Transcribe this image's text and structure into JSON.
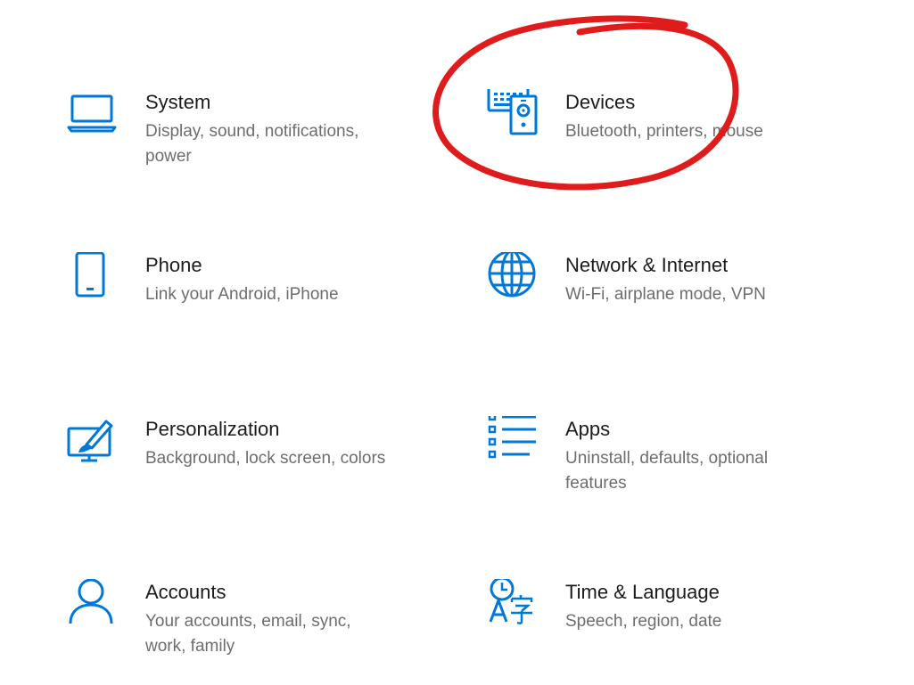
{
  "accent_color": "#0078d7",
  "annotation_color": "#e01b1b",
  "tiles": [
    {
      "title": "System",
      "description": "Display, sound, notifications, power",
      "icon": "laptop-icon"
    },
    {
      "title": "Devices",
      "description": "Bluetooth, printers, mouse",
      "icon": "devices-icon"
    },
    {
      "title": "Phone",
      "description": "Link your Android, iPhone",
      "icon": "phone-icon"
    },
    {
      "title": "Network & Internet",
      "description": "Wi-Fi, airplane mode, VPN",
      "icon": "globe-icon"
    },
    {
      "title": "Personalization",
      "description": "Background, lock screen, colors",
      "icon": "personalization-icon"
    },
    {
      "title": "Apps",
      "description": "Uninstall, defaults, optional features",
      "icon": "apps-list-icon"
    },
    {
      "title": "Accounts",
      "description": "Your accounts, email, sync, work, family",
      "icon": "person-icon"
    },
    {
      "title": "Time & Language",
      "description": "Speech, region, date",
      "icon": "time-language-icon"
    }
  ]
}
